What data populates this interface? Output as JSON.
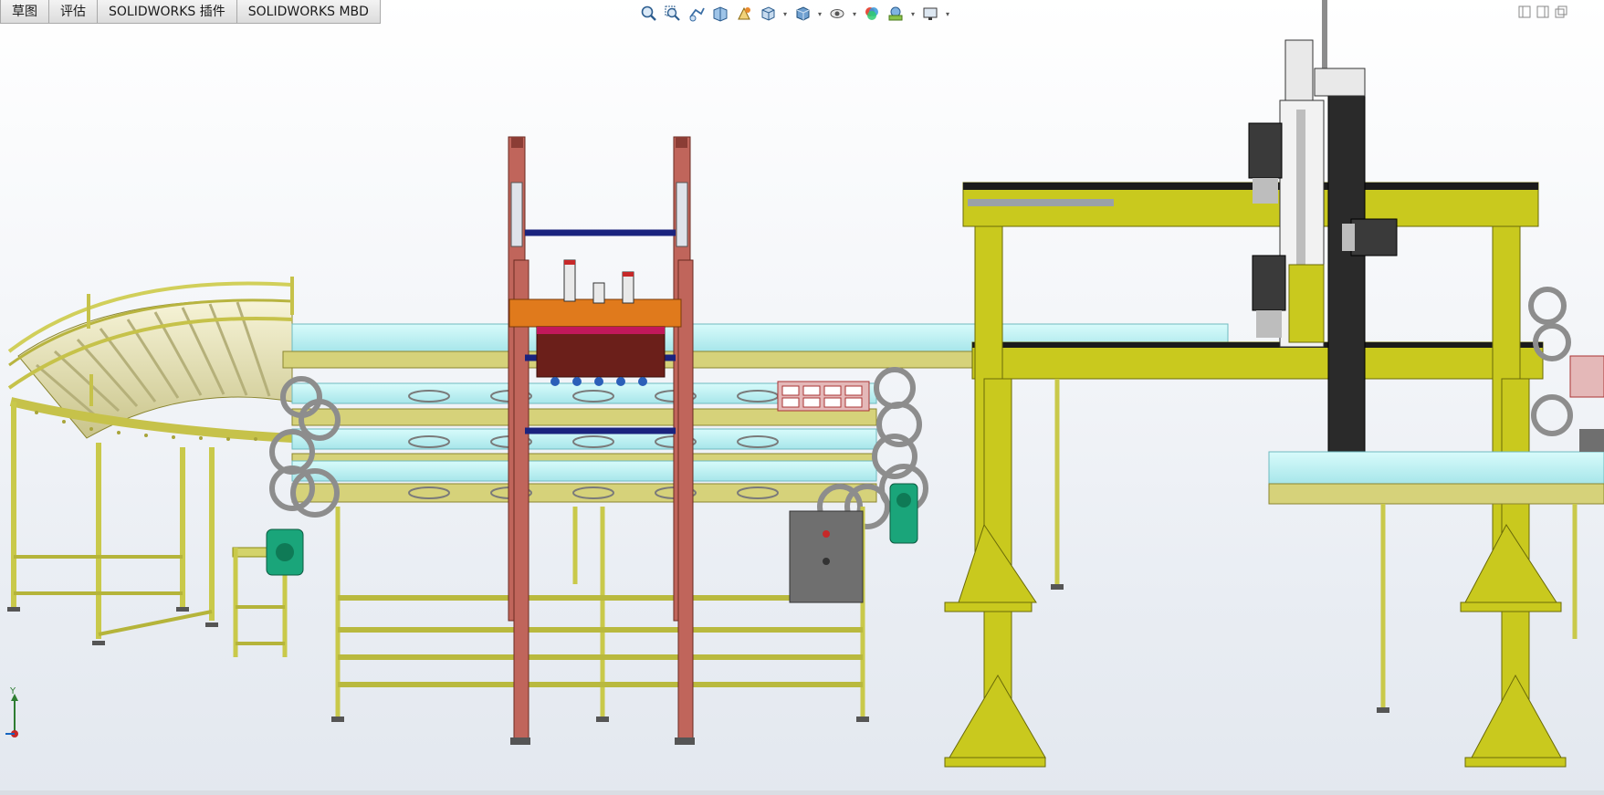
{
  "tabs": [
    {
      "id": "sketch",
      "label": "草图"
    },
    {
      "id": "evaluate",
      "label": "评估"
    },
    {
      "id": "addins",
      "label": "SOLIDWORKS 插件"
    },
    {
      "id": "mbd",
      "label": "SOLIDWORKS MBD"
    }
  ],
  "heads_up_toolbar": [
    {
      "name": "zoom-to-fit-icon"
    },
    {
      "name": "zoom-to-area-icon"
    },
    {
      "name": "previous-view-icon"
    },
    {
      "name": "section-view-icon"
    },
    {
      "name": "dynamic-annotation-icon"
    },
    {
      "name": "view-orientation-icon",
      "dropdown": true
    },
    {
      "name": "display-style-icon",
      "dropdown": true
    },
    {
      "name": "hide-show-items-icon",
      "dropdown": true
    },
    {
      "name": "edit-appearance-icon"
    },
    {
      "name": "apply-scene-icon",
      "dropdown": true
    },
    {
      "name": "view-settings-icon",
      "dropdown": true
    }
  ],
  "triad": {
    "axis_label": "Y"
  },
  "colors": {
    "frame_yellow": "#c9c91e",
    "frame_dark": "#8a8a10",
    "conveyor_cyan": "#bff5f5",
    "roller_tan": "#e8e3a8",
    "mast_red": "#c0655b",
    "block_orange": "#e07a1c",
    "bar_navy": "#1a237e",
    "motor_green": "#1aa57a",
    "panel_gray": "#6f6f6f",
    "chain_gray": "#9a9a9a"
  }
}
